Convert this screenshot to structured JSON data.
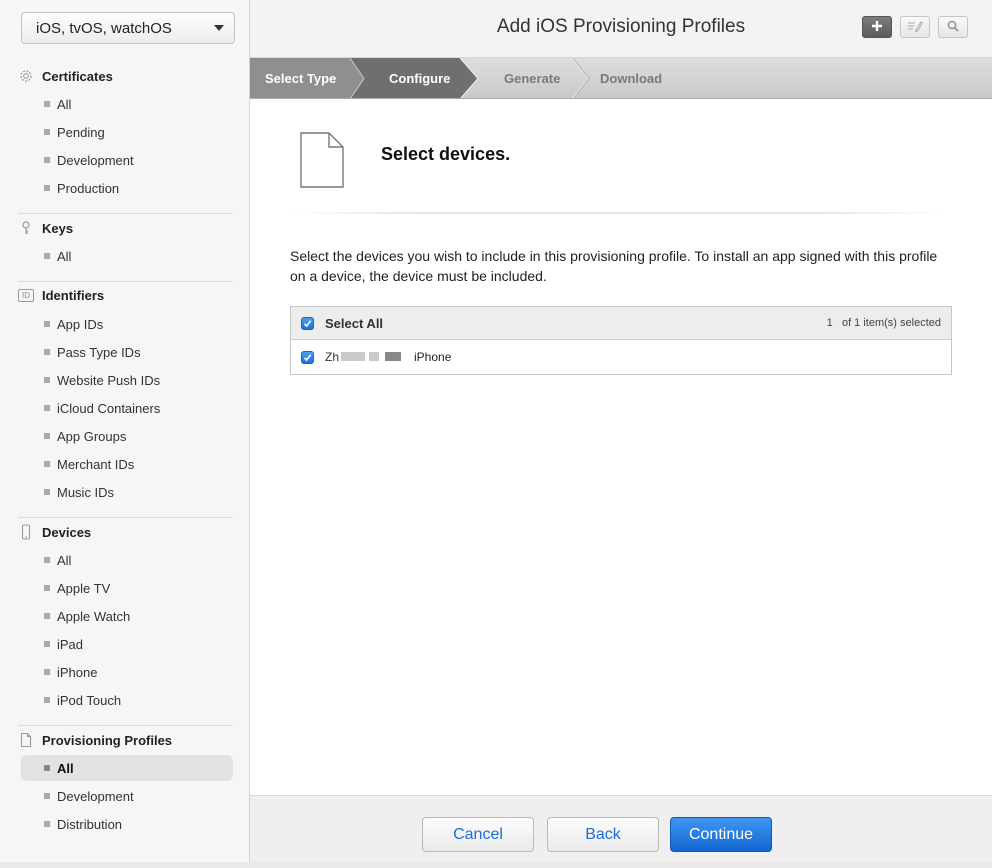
{
  "platform": {
    "label": "iOS, tvOS, watchOS"
  },
  "sidebar": {
    "certificates": {
      "title": "Certificates",
      "items": [
        "All",
        "Pending",
        "Development",
        "Production"
      ]
    },
    "keys": {
      "title": "Keys",
      "items": [
        "All"
      ]
    },
    "identifiers": {
      "title": "Identifiers",
      "icon_text": "ID",
      "items": [
        "App IDs",
        "Pass Type IDs",
        "Website Push IDs",
        "iCloud Containers",
        "App Groups",
        "Merchant IDs",
        "Music IDs"
      ]
    },
    "devices": {
      "title": "Devices",
      "items": [
        "All",
        "Apple TV",
        "Apple Watch",
        "iPad",
        "iPhone",
        "iPod Touch"
      ]
    },
    "profiles": {
      "title": "Provisioning Profiles",
      "items": [
        "All",
        "Development",
        "Distribution"
      ],
      "active_item": "All"
    }
  },
  "header": {
    "title": "Add iOS Provisioning Profiles",
    "icons": [
      "add-icon",
      "edit-icon",
      "search-icon"
    ]
  },
  "steps": [
    {
      "label": "Select Type",
      "state": "done"
    },
    {
      "label": "Configure",
      "state": "current"
    },
    {
      "label": "Generate",
      "state": "pending"
    },
    {
      "label": "Download",
      "state": "pending"
    }
  ],
  "main": {
    "title": "Select devices.",
    "description": "Select the devices you wish to include in this provisioning profile. To install an app signed with this profile on a device, the device must be included.",
    "table": {
      "select_all_label": "Select All",
      "selected_count": "1",
      "selection_suffix": "of 1 item(s) selected",
      "rows": [
        {
          "name_fragment": "Zh",
          "type": "iPhone",
          "checked": true
        }
      ]
    }
  },
  "footer": {
    "cancel_label": "Cancel",
    "back_label": "Back",
    "continue_label": "Continue"
  },
  "colors": {
    "accent": "#1a6fd6",
    "step_current": "#737373",
    "step_done": "#8f8f8f"
  }
}
